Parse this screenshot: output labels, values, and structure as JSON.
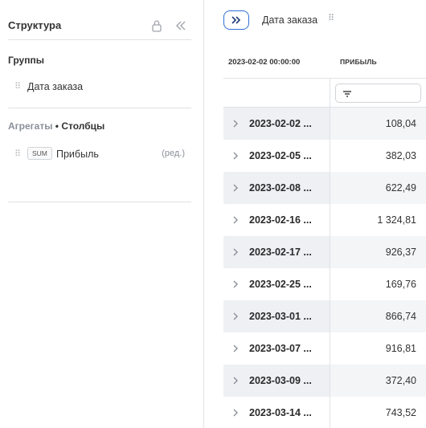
{
  "panel": {
    "title": "Структура",
    "groups_title": "Группы",
    "groups": [
      {
        "label": "Дата заказа"
      }
    ],
    "aggregates_title": "Агрегаты",
    "aggregates_sep": " • ",
    "columns_title": "Столбцы",
    "aggregates": [
      {
        "func": "SUM",
        "label": "Прибыль",
        "edit": "(ред.)"
      }
    ],
    "icons": {
      "lock": "lock-icon",
      "collapse": "double-chevron-left-icon",
      "drag": "drag-handle-icon"
    }
  },
  "toolbar": {
    "expand_icon": "double-chevron-right-icon",
    "group_chip": "Дата заказа"
  },
  "grid": {
    "head_date": "2023-02-02 00:00:00",
    "head_profit": "ПРИБЫЛЬ",
    "filter_placeholder": "",
    "rows": [
      {
        "date": "2023-02-02 ...",
        "value": "108,04"
      },
      {
        "date": "2023-02-05 ...",
        "value": "382,03"
      },
      {
        "date": "2023-02-08 ...",
        "value": "622,49"
      },
      {
        "date": "2023-02-16 ...",
        "value": "1 324,81"
      },
      {
        "date": "2023-02-17 ...",
        "value": "926,37"
      },
      {
        "date": "2023-02-25 ...",
        "value": "169,76"
      },
      {
        "date": "2023-03-01 ...",
        "value": "866,74"
      },
      {
        "date": "2023-03-07 ...",
        "value": "916,81"
      },
      {
        "date": "2023-03-09 ...",
        "value": "372,40"
      },
      {
        "date": "2023-03-14 ...",
        "value": "743,52"
      }
    ]
  },
  "colors": {
    "accent": "#2f6fd6",
    "alt_row": "#f4f5f7",
    "border": "#dfe2e6"
  }
}
